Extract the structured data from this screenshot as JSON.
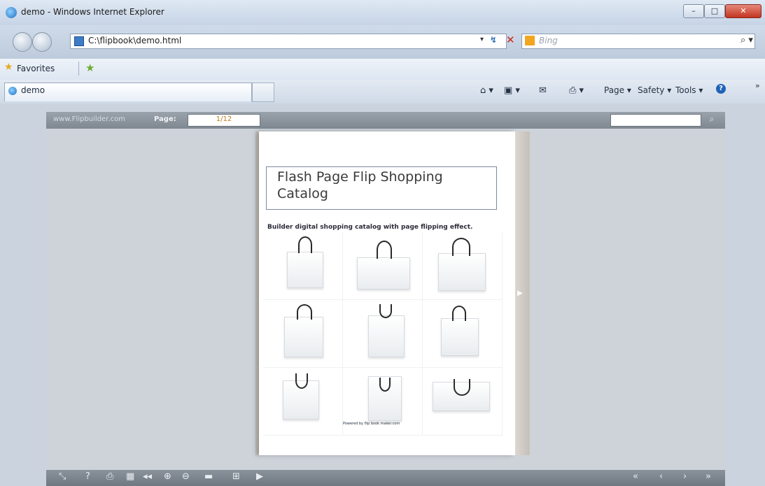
{
  "window": {
    "title": "demo - Windows Internet Explorer",
    "min": "–",
    "max": "□",
    "close": "✕"
  },
  "nav": {
    "address": "C:\\flipbook\\demo.html",
    "search_placeholder": "Bing",
    "dropdown": "▾",
    "refresh": "↯",
    "stop": "✕",
    "search_go": "⌕ ▾"
  },
  "favorites": {
    "label": "Favorites"
  },
  "tabs": [
    {
      "label": "demo"
    }
  ],
  "command_bar": {
    "page": "Page ▾",
    "safety": "Safety ▾",
    "tools": "Tools ▾",
    "help": "?",
    "more": "»",
    "home": "⌂ ▾",
    "feeds": "▣ ▾",
    "mail": "✉",
    "print": "⎙ ▾"
  },
  "viewer": {
    "site_link": "www.Flipbuilder.com",
    "page_label": "Page:",
    "page_value": "1/12",
    "search_icon": "⌕"
  },
  "catalog": {
    "title_line1": "Flash Page Flip Shopping",
    "title_line2": "Catalog",
    "subtitle": "Builder digital shopping catalog with page flipping effect.",
    "footer": "Powered by flip book maker.com",
    "next_arrow": "▶"
  },
  "bottom_toolbar": {
    "left": [
      "⤡",
      "?",
      "⎙",
      "▦",
      "◂◂",
      "⊕",
      "⊖",
      "▬",
      "⊞",
      "▶"
    ],
    "right": [
      "«",
      "‹",
      "›",
      "»"
    ]
  }
}
